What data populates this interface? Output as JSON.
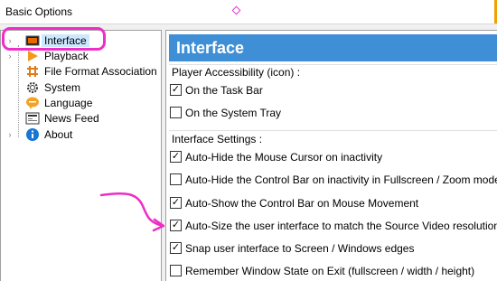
{
  "window": {
    "title": "Basic Options"
  },
  "sidebar": {
    "items": [
      {
        "label": "Interface",
        "icon": "interface-icon",
        "expandable": true,
        "selected": true
      },
      {
        "label": "Playback",
        "icon": "playback-icon",
        "expandable": true,
        "selected": false
      },
      {
        "label": "File Format Association",
        "icon": "file-format-icon",
        "expandable": false,
        "selected": false
      },
      {
        "label": "System",
        "icon": "system-gear-icon",
        "expandable": false,
        "selected": false
      },
      {
        "label": "Language",
        "icon": "language-icon",
        "expandable": false,
        "selected": false
      },
      {
        "label": "News Feed",
        "icon": "news-icon",
        "expandable": false,
        "selected": false
      },
      {
        "label": "About",
        "icon": "info-icon",
        "expandable": true,
        "selected": false
      }
    ]
  },
  "panel": {
    "header": "Interface",
    "groups": [
      {
        "label": "Player Accessibility (icon) :",
        "options": [
          {
            "label": "On the Task Bar",
            "checked": true
          },
          {
            "label": "On the System Tray",
            "checked": false
          }
        ]
      },
      {
        "label": "Interface Settings :",
        "options": [
          {
            "label": "Auto-Hide the Mouse Cursor on inactivity",
            "checked": true
          },
          {
            "label": "Auto-Hide the Control Bar on inactivity in Fullscreen / Zoom mode",
            "checked": false
          },
          {
            "label": "Auto-Show the Control Bar on Mouse Movement",
            "checked": true
          },
          {
            "label": "Auto-Size the user interface to match the Source Video resolution",
            "checked": true
          },
          {
            "label": "Snap user interface to Screen / Windows edges",
            "checked": true
          },
          {
            "label": "Remember Window State on Exit (fullscreen / width / height)",
            "checked": false
          }
        ]
      }
    ]
  },
  "colors": {
    "header_blue": "#3f8fd6",
    "annotation_magenta": "#ee2ec6",
    "selection": "#cce8ff"
  }
}
